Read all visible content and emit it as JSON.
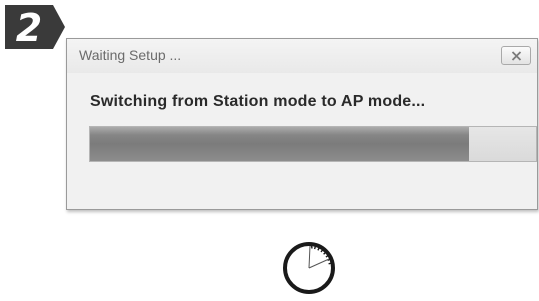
{
  "step": {
    "number": "2"
  },
  "dialog": {
    "title": "Waiting Setup ...",
    "message": "Switching from Station mode to AP mode...",
    "close_icon": "close-icon"
  },
  "progress": {
    "value_fraction": 0.85
  },
  "icons": {
    "clock": "clock-icon"
  },
  "colors": {
    "badge_fill": "#3a3a3a",
    "progress_fill": "#858585",
    "dialog_background": "#f1f1f1"
  }
}
